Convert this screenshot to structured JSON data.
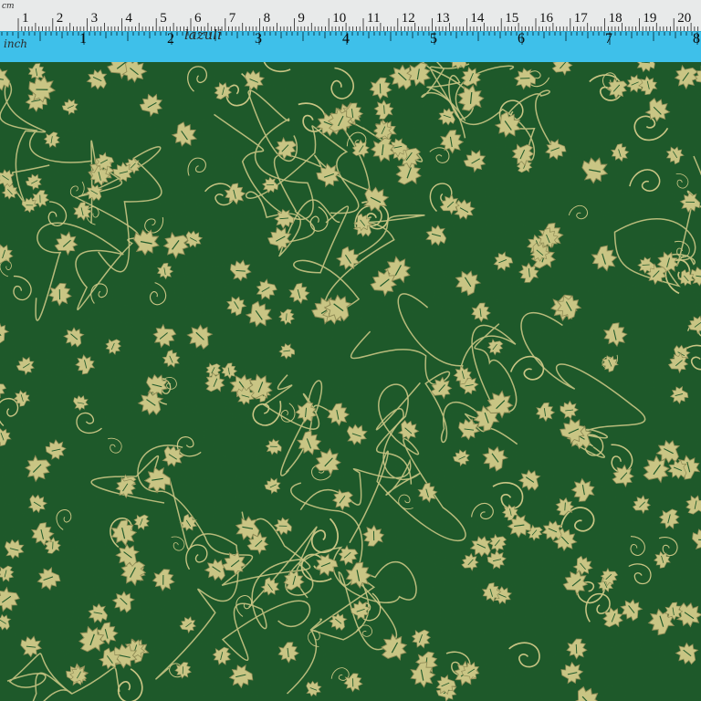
{
  "ruler": {
    "cm_numbers": [
      "1",
      "2",
      "3",
      "4",
      "5",
      "6",
      "7",
      "8",
      "9",
      "10",
      "11",
      "12",
      "13",
      "14",
      "15",
      "16",
      "17",
      "18",
      "19",
      "20"
    ],
    "inch_numbers": [
      "1",
      "2",
      "3",
      "4",
      "5",
      "6",
      "7",
      "8"
    ],
    "inch_label": "inch",
    "cm_label": "cm",
    "brand_label": "lazuli"
  },
  "fabric": {
    "background_color": "#1f5a2a",
    "motif_color": "#d9cf8d",
    "pattern": "gold holly leaves and swirling vines"
  },
  "colors": {
    "ruler_cm_bg": "#e8eaea",
    "ruler_in_bg": "#3ec0ea"
  }
}
